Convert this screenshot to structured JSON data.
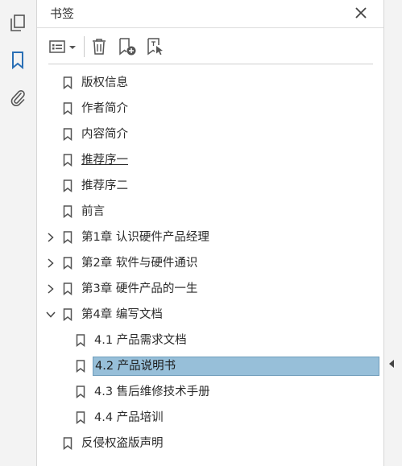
{
  "panel": {
    "title": "书签"
  },
  "toolbar": {
    "options_icon": "list-options-icon",
    "delete_icon": "trash-icon",
    "new_bookmark_icon": "bookmark-add-icon",
    "new_from_structure_icon": "bookmark-cursor-icon"
  },
  "rail": {
    "items": [
      "pages-icon",
      "bookmark-icon",
      "paperclip-icon"
    ]
  },
  "colors": {
    "accent": "#2a6fb5",
    "selection": "#97bfd9",
    "selection_border": "#6f9dbb"
  },
  "bookmarks": [
    {
      "label": "版权信息"
    },
    {
      "label": "作者简介"
    },
    {
      "label": "内容简介"
    },
    {
      "label": "推荐序一"
    },
    {
      "label": "推荐序二"
    },
    {
      "label": "前言"
    },
    {
      "label": "第1章 认识硬件产品经理"
    },
    {
      "label": "第2章 软件与硬件通识"
    },
    {
      "label": "第3章 硬件产品的一生"
    },
    {
      "label": "第4章 编写文档"
    },
    {
      "label": "4.1 产品需求文档"
    },
    {
      "label": "4.2 产品说明书"
    },
    {
      "label": "4.3 售后维修技术手册"
    },
    {
      "label": "4.4 产品培训"
    },
    {
      "label": "反侵权盗版声明"
    }
  ]
}
